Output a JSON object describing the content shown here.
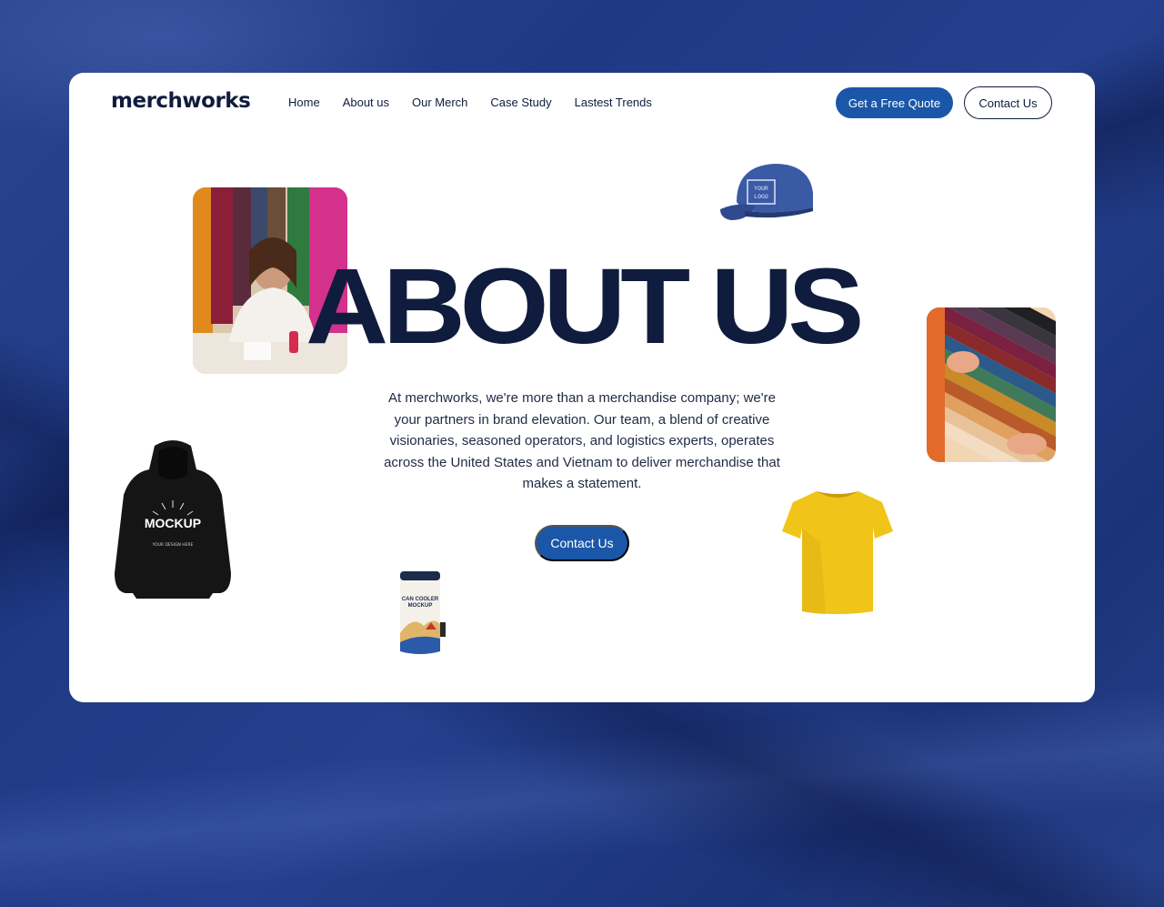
{
  "header": {
    "logo": "merchworks",
    "nav": [
      "Home",
      "About us",
      "Our Merch",
      "Case Study",
      "Lastest Trends"
    ],
    "quote_button": "Get a Free Quote",
    "contact_button": "Contact Us"
  },
  "hero": {
    "title": "ABOUT US",
    "description": "At merchworks, we're more than a merchandise company; we're your partners in brand elevation. Our team, a blend of creative visionaries, seasoned operators, and logistics experts, operates across the United States and Vietnam to deliver merchandise that makes a statement.",
    "cta": "Contact Us"
  },
  "products": {
    "cap_print": "YOUR LOGO",
    "hoodie_print": "MOCKUP",
    "hoodie_sub": "YOUR DESIGN HERE",
    "can_print_1": "CAN COOLER",
    "can_print_2": "MOCKUP"
  },
  "colors": {
    "brand_blue": "#1b57a8",
    "navy_text": "#0f1c3d",
    "background": "#1e3a86",
    "tshirt_yellow": "#f0c419"
  },
  "icons": [
    "cap-image",
    "hoodie-image",
    "tshirt-image",
    "can-cooler-image",
    "designer-photo",
    "fabric-swatch-photo"
  ]
}
